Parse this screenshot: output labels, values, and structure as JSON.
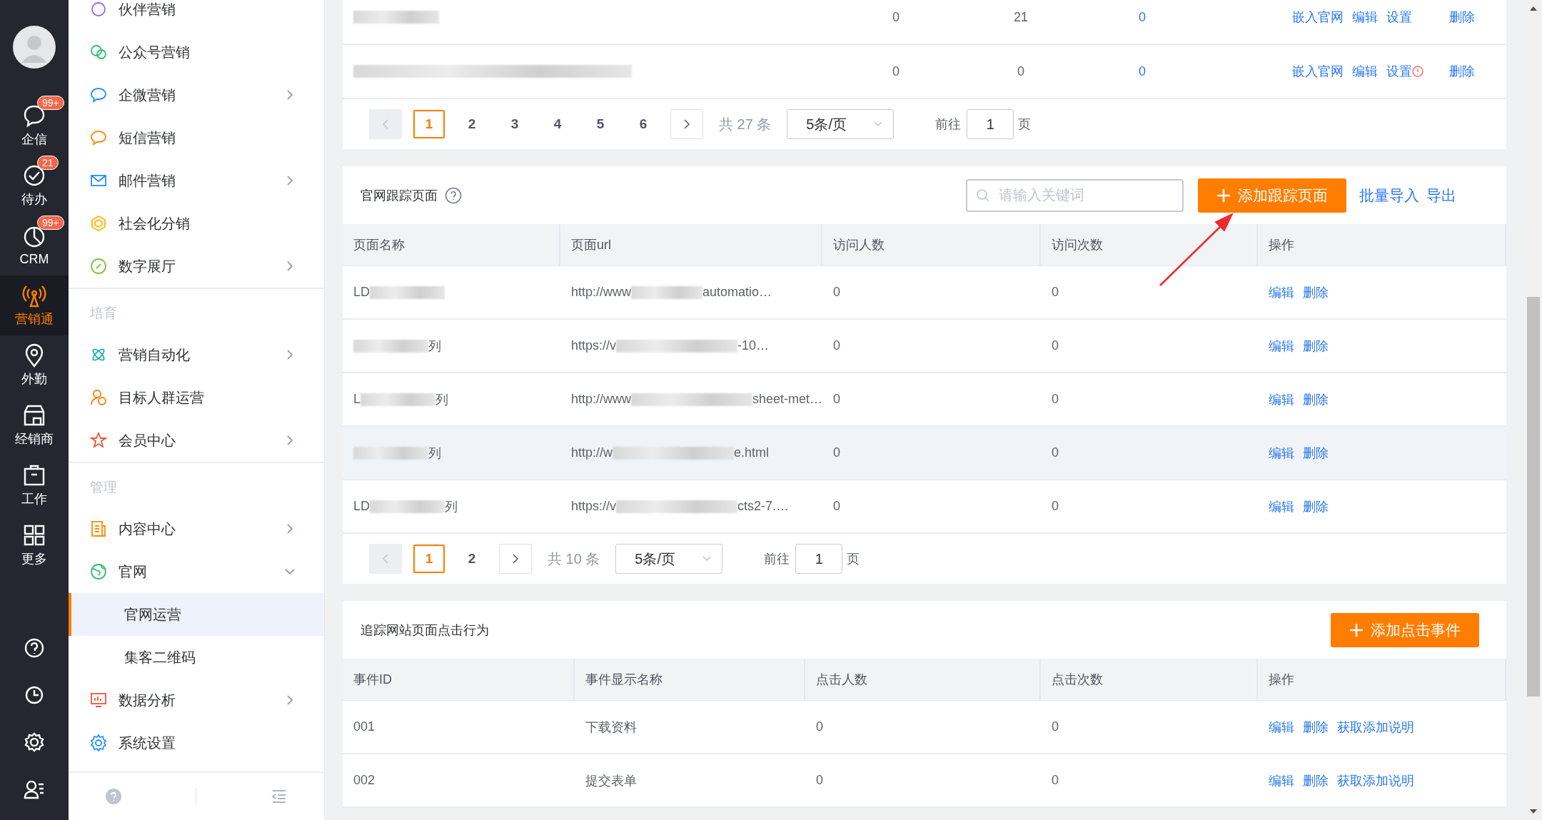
{
  "rail": {
    "items": [
      {
        "label": "企信",
        "badge": "99+",
        "selected": false
      },
      {
        "label": "待办",
        "badge": "21",
        "selected": false
      },
      {
        "label": "CRM",
        "badge": "99+",
        "selected": false
      },
      {
        "label": "营销通",
        "selected": true
      },
      {
        "label": "外勤",
        "selected": false
      },
      {
        "label": "经销商",
        "selected": false
      },
      {
        "label": "工作",
        "selected": false
      },
      {
        "label": "更多",
        "selected": false
      }
    ]
  },
  "sidebar": {
    "sections": [
      {
        "items": [
          {
            "label": "伙伴营销",
            "expandable": false
          },
          {
            "label": "公众号营销",
            "expandable": false
          },
          {
            "label": "企微营销",
            "expandable": true,
            "expanded": false
          },
          {
            "label": "短信营销",
            "expandable": false
          },
          {
            "label": "邮件营销",
            "expandable": true,
            "expanded": false
          },
          {
            "label": "社会化分销",
            "expandable": false
          },
          {
            "label": "数字展厅",
            "expandable": true,
            "expanded": false
          }
        ]
      },
      {
        "heading": "培育",
        "items": [
          {
            "label": "营销自动化",
            "expandable": true,
            "expanded": false
          },
          {
            "label": "目标人群运营",
            "expandable": false
          },
          {
            "label": "会员中心",
            "expandable": true,
            "expanded": false
          }
        ]
      },
      {
        "heading": "管理",
        "items": [
          {
            "label": "内容中心",
            "expandable": true,
            "expanded": false
          },
          {
            "label": "官网",
            "expandable": true,
            "expanded": true,
            "children": [
              {
                "label": "官网运营",
                "selected": true
              },
              {
                "label": "集客二维码",
                "selected": false
              }
            ]
          },
          {
            "label": "数据分析",
            "expandable": true,
            "expanded": false
          },
          {
            "label": "系统设置",
            "expandable": false
          }
        ]
      }
    ]
  },
  "top_table": {
    "rows": [
      {
        "column_2": "0",
        "column_3": "21",
        "column_4": "0",
        "actions": [
          {
            "label": "嵌入官网"
          },
          {
            "label": "编辑"
          },
          {
            "label": "设置",
            "warning": false
          },
          {
            "label": "删除"
          }
        ]
      },
      {
        "column_2": "0",
        "column_3": "0",
        "column_4": "0",
        "actions": [
          {
            "label": "嵌入官网"
          },
          {
            "label": "编辑"
          },
          {
            "label": "设置",
            "warning": true
          },
          {
            "label": "删除"
          }
        ]
      }
    ],
    "pagination": {
      "prev_disabled": true,
      "pages": [
        {
          "label": "1",
          "selected": true
        },
        {
          "label": "2",
          "selected": false
        },
        {
          "label": "3",
          "selected": false
        },
        {
          "label": "4",
          "selected": false
        },
        {
          "label": "5",
          "selected": false
        },
        {
          "label": "6",
          "selected": false
        }
      ],
      "total": "共 27 条",
      "page_size": "5条/页",
      "goto_label": "前往",
      "goto_value": "1",
      "goto_unit": "页"
    }
  },
  "tracking_pages": {
    "title": "官网跟踪页面",
    "search": {
      "placeholder": "请输入关键词"
    },
    "add_button": "添加跟踪页面",
    "import_link": "批量导入",
    "export_link": "导出",
    "columns": [
      "页面名称",
      "页面url",
      "访问人数",
      "访问次数",
      "操作"
    ],
    "rows": [
      {
        "highlighted": false,
        "name": {
          "prefix": "LD"
        },
        "url": {
          "prefix": "http://www",
          "suffix": "automatio…"
        },
        "visitors": "0",
        "visits": "0",
        "actions": [
          "编辑",
          "删除"
        ]
      },
      {
        "highlighted": false,
        "name": {
          "suffix": "列"
        },
        "url": {
          "prefix": "https://v",
          "suffix": "-10…"
        },
        "visitors": "0",
        "visits": "0",
        "actions": [
          "编辑",
          "删除"
        ]
      },
      {
        "highlighted": false,
        "name": {
          "prefix": "L",
          "suffix": "列"
        },
        "url": {
          "prefix": "http://www",
          "suffix": "sheet-met…"
        },
        "visitors": "0",
        "visits": "0",
        "actions": [
          "编辑",
          "删除"
        ]
      },
      {
        "highlighted": true,
        "name": {
          "suffix": "列"
        },
        "url": {
          "prefix": "http://w",
          "suffix": "e.html"
        },
        "visitors": "0",
        "visits": "0",
        "actions": [
          "编辑",
          "删除"
        ]
      },
      {
        "highlighted": false,
        "name": {
          "prefix": "LD",
          "suffix": "列"
        },
        "url": {
          "prefix": "https://v",
          "suffix": "cts2-7.…"
        },
        "visitors": "0",
        "visits": "0",
        "actions": [
          "编辑",
          "删除"
        ]
      }
    ],
    "pagination": {
      "prev_disabled": true,
      "pages": [
        {
          "label": "1",
          "selected": true
        },
        {
          "label": "2",
          "selected": false
        }
      ],
      "total": "共 10 条",
      "page_size": "5条/页",
      "goto_label": "前往",
      "goto_value": "1",
      "goto_unit": "页"
    }
  },
  "click_events": {
    "title": "追踪网站页面点击行为",
    "add_button": "添加点击事件",
    "columns": [
      "事件ID",
      "事件显示名称",
      "点击人数",
      "点击次数",
      "操作"
    ],
    "rows": [
      {
        "id": "001",
        "name": "下载资料",
        "clickers": "0",
        "clicks": "0",
        "actions": [
          "编辑",
          "删除",
          "获取添加说明"
        ]
      },
      {
        "id": "002",
        "name": "提交表单",
        "clickers": "0",
        "clicks": "0",
        "actions": [
          "编辑",
          "删除",
          "获取添加说明"
        ]
      }
    ]
  }
}
